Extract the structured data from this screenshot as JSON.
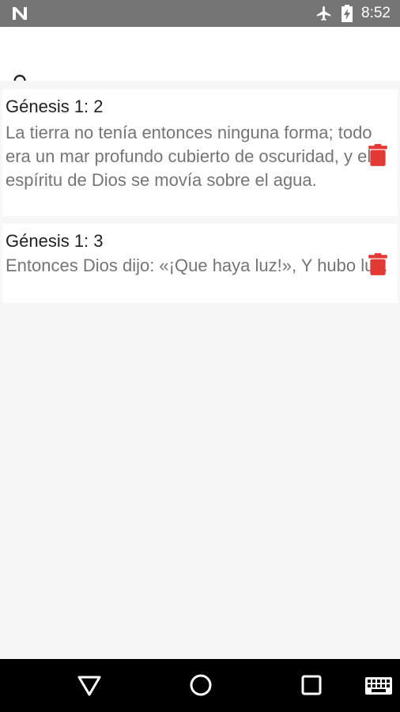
{
  "status_bar": {
    "time": "8:52",
    "icons": [
      "n-logo-icon",
      "airplane-mode-icon",
      "battery-charging-icon"
    ],
    "background": "#757575"
  },
  "search": {
    "icon": "search-icon",
    "placeholder": "",
    "value": ""
  },
  "verses": [
    {
      "reference": "Génesis 1: 2",
      "text": "La tierra no tenía entonces ninguna forma; todo era un mar profundo cubierto de oscuridad, y el espíritu de Dios se movía sobre el agua."
    },
    {
      "reference": "Génesis 1: 3",
      "text": "Entonces Dios dijo: «¡Que haya luz!», Y hubo luz."
    }
  ],
  "colors": {
    "delete_icon": "#e53935",
    "reference_text": "#212121",
    "verse_text": "#757575"
  },
  "nav_bar": {
    "buttons": [
      "back-icon",
      "home-icon",
      "recents-icon",
      "keyboard-icon"
    ]
  }
}
